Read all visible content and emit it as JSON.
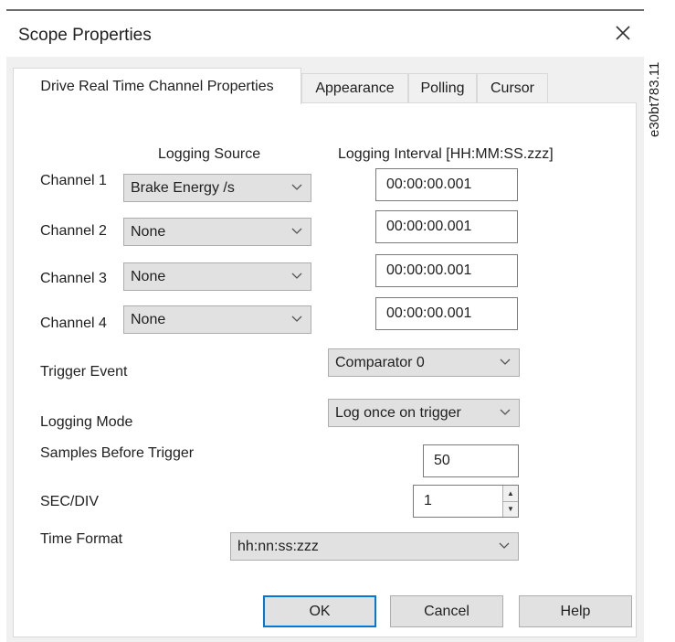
{
  "window": {
    "title": "Scope Properties",
    "close_glyph": "✕",
    "figure_code": "e30bt783.11"
  },
  "tabs": [
    {
      "label": "Drive Real Time Channel Properties",
      "active": true
    },
    {
      "label": "Appearance",
      "active": false
    },
    {
      "label": "Polling",
      "active": false
    },
    {
      "label": "Cursor",
      "active": false
    }
  ],
  "headers": {
    "logging_source": "Logging Source",
    "logging_interval": "Logging Interval [HH:MM:SS.zzz]"
  },
  "channels": [
    {
      "label": "Channel 1",
      "source": "Brake Energy /s",
      "interval": "00:00:00.001"
    },
    {
      "label": "Channel 2",
      "source": "None",
      "interval": "00:00:00.001"
    },
    {
      "label": "Channel 3",
      "source": "None",
      "interval": "00:00:00.001"
    },
    {
      "label": "Channel 4",
      "source": "None",
      "interval": "00:00:00.001"
    }
  ],
  "trigger_event": {
    "label": "Trigger Event",
    "value": "Comparator 0"
  },
  "logging_mode": {
    "label": "Logging Mode",
    "value": "Log once on trigger"
  },
  "samples_before_trigger": {
    "label": "Samples Before Trigger",
    "value": "50"
  },
  "sec_div": {
    "label": "SEC/DIV",
    "value": "1"
  },
  "time_format": {
    "label": "Time Format",
    "value": "hh:nn:ss:zzz"
  },
  "buttons": {
    "ok": "OK",
    "cancel": "Cancel",
    "help": "Help"
  },
  "colors": {
    "accent": "#0078d7",
    "dialog_bg": "#f0f0f0",
    "combo_bg": "#e1e1e1"
  }
}
